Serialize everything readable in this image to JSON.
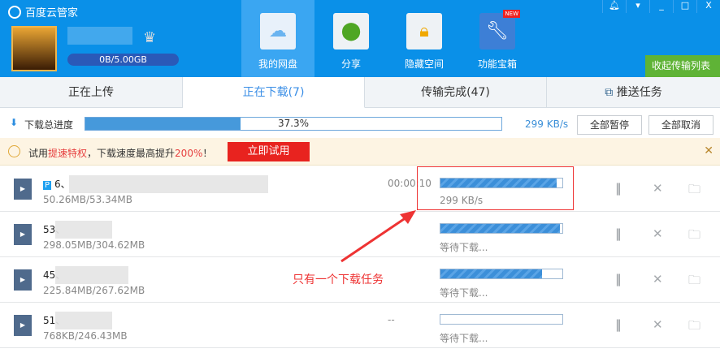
{
  "app": {
    "title": "百度云管家",
    "quota": "0B/5.00GB"
  },
  "nav": [
    {
      "label": "我的网盘",
      "icon": "cloud-icon"
    },
    {
      "label": "分享",
      "icon": "share-icon"
    },
    {
      "label": "隐藏空间",
      "icon": "lock-icon"
    },
    {
      "label": "功能宝箱",
      "icon": "wrench-icon",
      "badge": "NEW"
    }
  ],
  "window_controls": [
    "bell",
    "menu",
    "minimize",
    "maximize",
    "close"
  ],
  "collapse_label": "收起传输列表",
  "tabs": [
    {
      "label": "正在上传"
    },
    {
      "label": "正在下载(7)"
    },
    {
      "label": "传输完成(47)"
    },
    {
      "label": "推送任务"
    }
  ],
  "progress": {
    "label": "下载总进度",
    "percent_text": "37.3%",
    "percent": 37.3,
    "speed": "299 KB/s",
    "pause_all": "全部暂停",
    "cancel_all": "全部取消"
  },
  "banner": {
    "pre": "试用",
    "highlight": "提速特权",
    "mid": "，下载速度最高提升",
    "pct": "200%",
    "end": "！",
    "button": "立即试用",
    "close": "✕"
  },
  "rows": [
    {
      "name": "6、",
      "size": "50.26MB/53.34MB",
      "eta": "00:00:10",
      "progress": 95,
      "status": "299 KB/s",
      "tag": "P"
    },
    {
      "name": "53、",
      "size": "298.05MB/304.62MB",
      "eta": "",
      "progress": 98,
      "status": "等待下载..."
    },
    {
      "name": "45、",
      "size": "225.84MB/267.62MB",
      "eta": "",
      "progress": 83,
      "status": "等待下载..."
    },
    {
      "name": "51、",
      "size": "768KB/246.43MB",
      "eta": "--",
      "progress": 0,
      "status": "等待下载..."
    }
  ],
  "annotation": "只有一个下载任务"
}
